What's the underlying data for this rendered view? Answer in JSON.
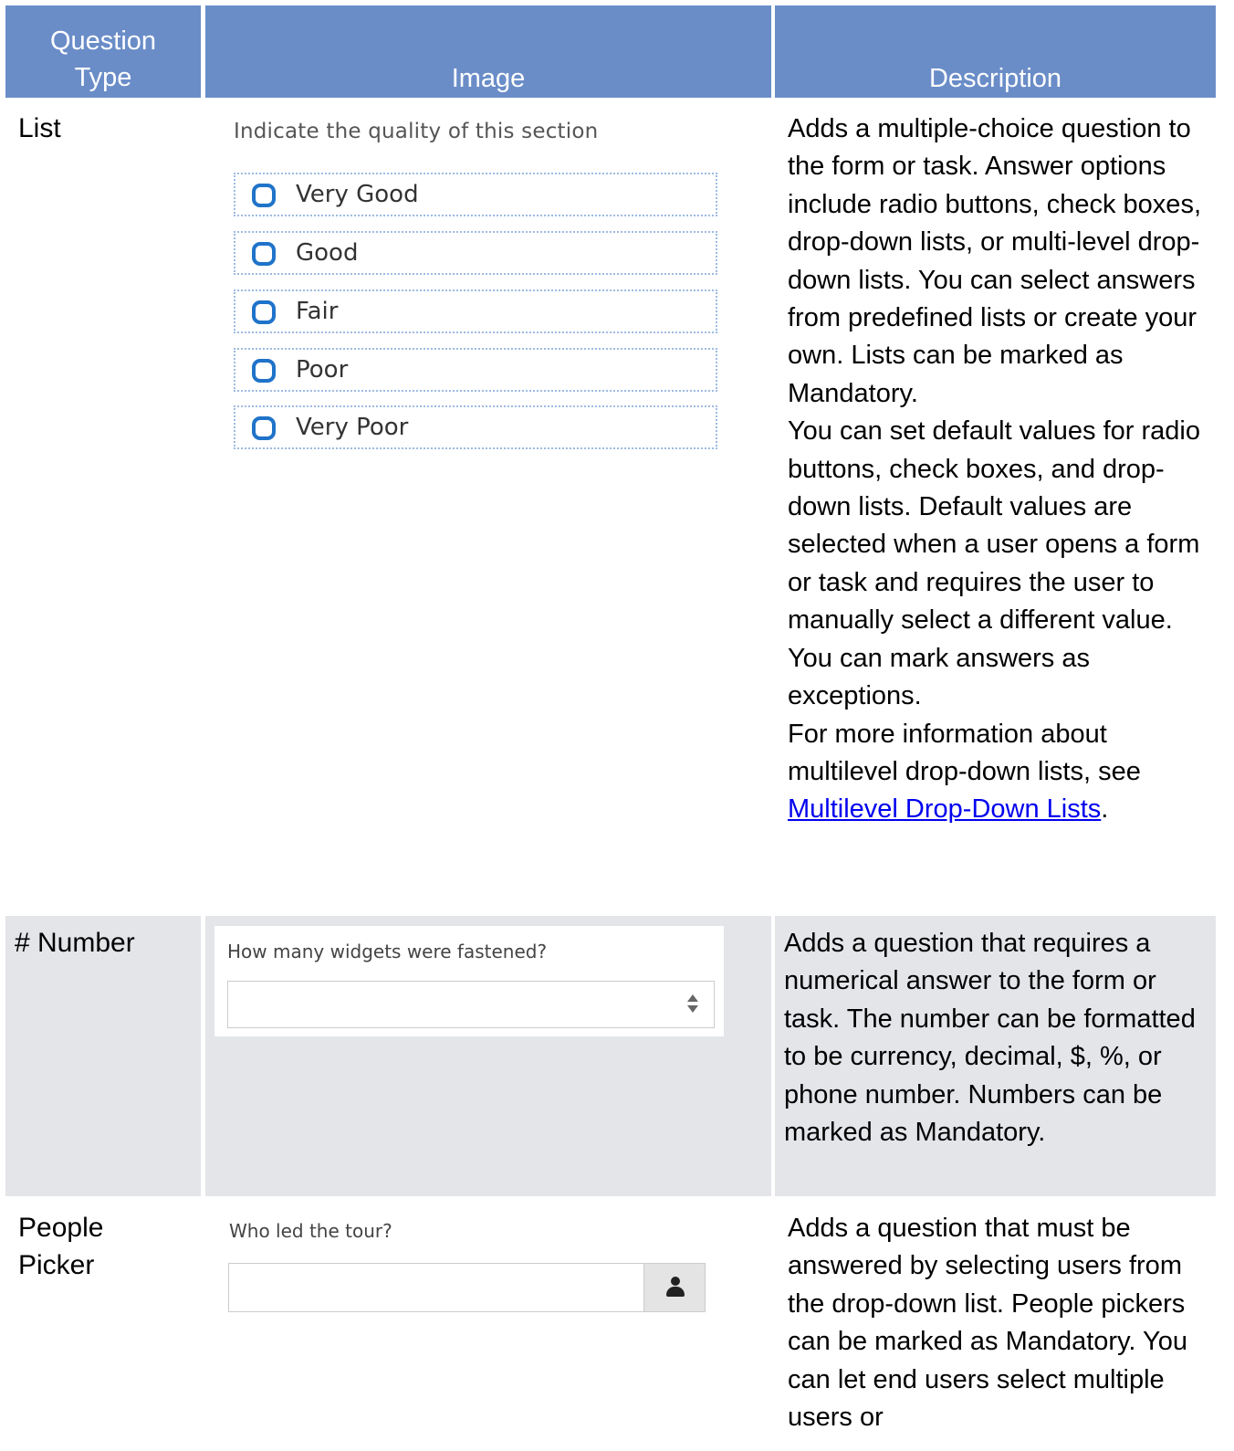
{
  "table": {
    "headers": {
      "question_type_line1": "Question",
      "question_type_line2": "Type",
      "image": "Image",
      "description": "Description"
    },
    "rows": {
      "list": {
        "type": "List",
        "image": {
          "question": "Indicate the quality of this section",
          "options": [
            "Very Good",
            "Good",
            "Fair",
            "Poor",
            "Very Poor"
          ]
        },
        "description": {
          "p1": "Adds a multiple-choice question to the form or task. Answer options include radio buttons, check boxes, drop-down lists, or multi-level drop-down lists. You can select answers from predefined lists or create your own. Lists can be marked as Mandatory.",
          "p2": "You can set default values for radio buttons, check boxes, and drop-down lists. Default values are selected when a user opens a form or task and requires the user to manually select a different value.",
          "p3": "You can mark answers as exceptions.",
          "p4_prefix": "For more information about multilevel drop-down lists, see ",
          "p4_link": "Multilevel Drop-Down Lists",
          "p4_suffix": "."
        }
      },
      "number": {
        "type": "# Number",
        "image": {
          "question": "How many widgets were fastened?",
          "value": ""
        },
        "description": "Adds a question that requires a numerical answer to the form or task. The number can be formatted to be currency, decimal, $, %, or phone number. Numbers can be marked as Mandatory."
      },
      "people_picker": {
        "type_line1": "People",
        "type_line2": "Picker",
        "image": {
          "question": "Who led the tour?",
          "value": ""
        },
        "description": "Adds a question that must be answered by selecting users from the drop-down list. People pickers can be marked as Mandatory. You can let end users select multiple users or"
      }
    }
  },
  "colors": {
    "header_bg": "#6a8dc8",
    "alt_row_bg": "#e3e5e9",
    "link": "#0000ee",
    "radio": "#1f73c9"
  },
  "icons": [
    "radio-icon",
    "spinner-icon",
    "person-icon"
  ]
}
